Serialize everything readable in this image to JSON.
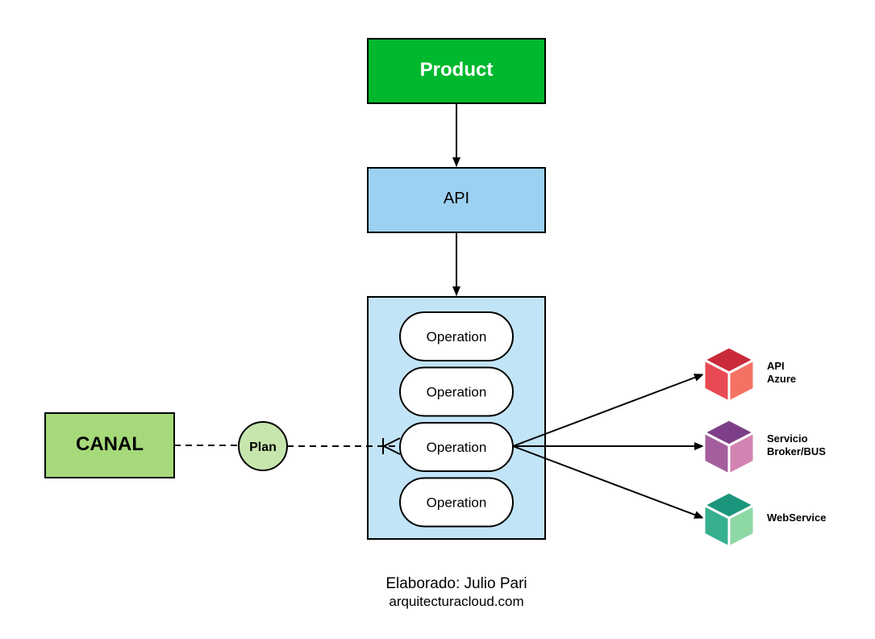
{
  "nodes": {
    "product": {
      "label": "Product",
      "fill": "#00b82e"
    },
    "api": {
      "label": "API",
      "fill": "#9dd1f1"
    },
    "operations_container": {
      "fill": "#c2e4f7"
    },
    "operations": [
      "Operation",
      "Operation",
      "Operation",
      "Operation"
    ],
    "canal": {
      "label": "CANAL",
      "fill": "#a6d97a"
    },
    "plan": {
      "label": "Plan",
      "fill": "#c7e6ad"
    }
  },
  "services": [
    {
      "lines": [
        "API",
        "Azure"
      ],
      "icon": "cube-icon",
      "colors": {
        "top": "#c82a3a",
        "left": "#e84a53",
        "right": "#f47263"
      }
    },
    {
      "lines": [
        "Servicio",
        "Broker/BUS"
      ],
      "icon": "cube-icon",
      "colors": {
        "top": "#7d3f87",
        "left": "#a45e9d",
        "right": "#d283b1"
      }
    },
    {
      "lines": [
        "WebService"
      ],
      "icon": "cube-icon",
      "colors": {
        "top": "#1a957b",
        "left": "#36b08f",
        "right": "#8ed8a6"
      }
    }
  ],
  "footer": {
    "author": "Elaborado: Julio Pari",
    "site": "arquitecturacloud.com"
  }
}
